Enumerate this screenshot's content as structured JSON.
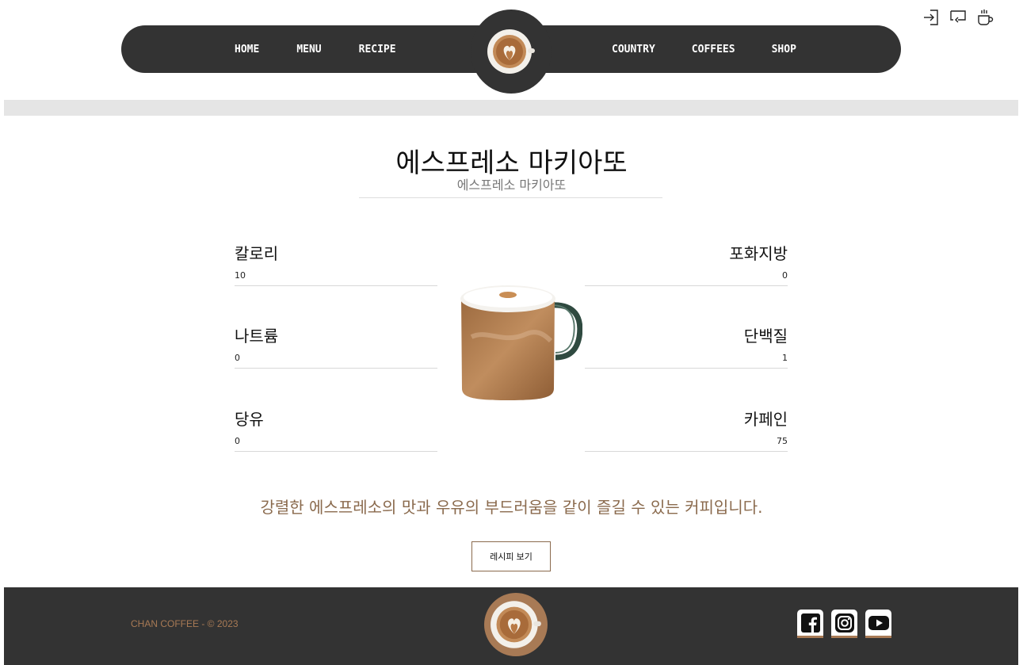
{
  "utility_icons": [
    "login-icon",
    "repeat-icon",
    "coffee-cup-icon"
  ],
  "nav": {
    "left": [
      "HOME",
      "MENU",
      "RECIPE"
    ],
    "right": [
      "COUNTRY",
      "COFFEES",
      "SHOP"
    ],
    "logo_icon": "latte-art-cup-icon"
  },
  "product": {
    "title": "에스프레소 마키아또",
    "subtitle": "에스프레소 마키아또",
    "image_icon": "latte-mug-image",
    "nutrition": {
      "calories": {
        "label": "칼로리",
        "value": "10"
      },
      "sodium": {
        "label": "나트륨",
        "value": "0"
      },
      "sugar": {
        "label": "당유",
        "value": "0"
      },
      "saturated_fat": {
        "label": "포화지방",
        "value": "0"
      },
      "protein": {
        "label": "단백질",
        "value": "1"
      },
      "caffeine": {
        "label": "카페인",
        "value": "75"
      }
    },
    "description": "강렬한 에스프레소의 맛과 우유의 부드러움을 같이 즐길 수 있는 커피입니다.",
    "recipe_button": "레시피 보기"
  },
  "footer": {
    "copyright": "CHAN COFFEE - © 2023",
    "social_icons": [
      "facebook-icon",
      "instagram-icon",
      "youtube-icon"
    ]
  },
  "colors": {
    "nav_bg": "#333333",
    "accent": "#a87a55",
    "strip": "#e5e5e5"
  }
}
